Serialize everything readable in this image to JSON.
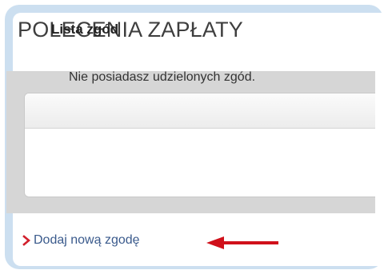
{
  "page": {
    "title": "POLECENIA ZAPŁATY"
  },
  "consents": {
    "heading": "Lista zgód",
    "empty_message": "Nie posiadasz udzielonych zgód."
  },
  "actions": {
    "add_link_label": "Dodaj nową zgodę"
  },
  "icons": {
    "link_chevron": "chevron-right-icon",
    "pointer_arrow": "arrow-left-icon"
  },
  "colors": {
    "frame": "#ccdff0",
    "chevron": "#d21f2b",
    "link": "#3a5a8c",
    "arrow": "#d0101a"
  }
}
